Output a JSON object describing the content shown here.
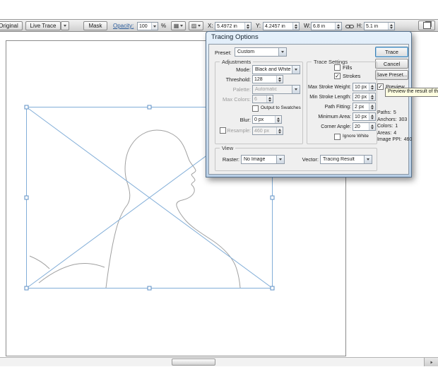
{
  "colors": {
    "selection_blue": "#82aed8",
    "titlebar_blue": "#bcd4ec",
    "tooltip_bg": "#ffffe1",
    "dialog_bg": "#efefef"
  },
  "control_bar": {
    "original_button": "Original",
    "live_trace_button": "Live Trace",
    "mask_button": "Mask",
    "opacity_label": "Opacity:",
    "opacity_value": "100",
    "percent_label": "%",
    "x_label": "X:",
    "x_value": "5.4972 in",
    "y_label": "Y:",
    "y_value": "4.2457 in",
    "w_label": "W:",
    "w_value": "6.8 in",
    "h_label": "H:",
    "h_value": "5.1 in"
  },
  "dialog": {
    "title": "Tracing Options",
    "preset_label": "Preset:",
    "preset_value": "Custom",
    "trace_button": "Trace",
    "cancel_button": "Cancel",
    "save_preset_button": "Save Preset...",
    "preview_label": "Preview",
    "checks": {
      "fills": "",
      "strokes": "✓",
      "output_to_swatches": "",
      "resample": "",
      "ignore_white": "",
      "preview": "✓"
    },
    "adjustments": {
      "legend": "Adjustments",
      "mode_label": "Mode:",
      "mode_value": "Black and White",
      "threshold_label": "Threshold:",
      "threshold_value": "128",
      "palette_label": "Palette:",
      "palette_value": "Automatic",
      "max_colors_label": "Max Colors:",
      "max_colors_value": "6",
      "output_to_swatches_label": "Output to Swatches",
      "blur_label": "Blur:",
      "blur_value": "0 px",
      "resample_label": "Resample:",
      "resample_value": "460 px"
    },
    "trace_settings": {
      "legend": "Trace Settings",
      "fills_label": "Fills",
      "strokes_label": "Strokes",
      "max_stroke_weight_label": "Max Stroke Weight:",
      "max_stroke_weight_value": "10 px",
      "min_stroke_length_label": "Min Stroke Length:",
      "min_stroke_length_value": "20 px",
      "path_fitting_label": "Path Fitting:",
      "path_fitting_value": "2 px",
      "minimum_area_label": "Minimum Area:",
      "minimum_area_value": "10 px",
      "corner_angle_label": "Corner Angle:",
      "corner_angle_value": "20",
      "ignore_white_label": "Ignore White"
    },
    "view": {
      "legend": "View",
      "raster_label": "Raster:",
      "raster_value": "No Image",
      "vector_label": "Vector:",
      "vector_value": "Tracing Result"
    },
    "stats": [
      {
        "label": "Paths:",
        "value": "5"
      },
      {
        "label": "Anchors:",
        "value": "303"
      },
      {
        "label": "Colors:",
        "value": "1"
      },
      {
        "label": "Areas:",
        "value": "4"
      },
      {
        "label": "Image PPI:",
        "value": "460"
      }
    ]
  },
  "tooltip_text": "Preview the result of the current s"
}
